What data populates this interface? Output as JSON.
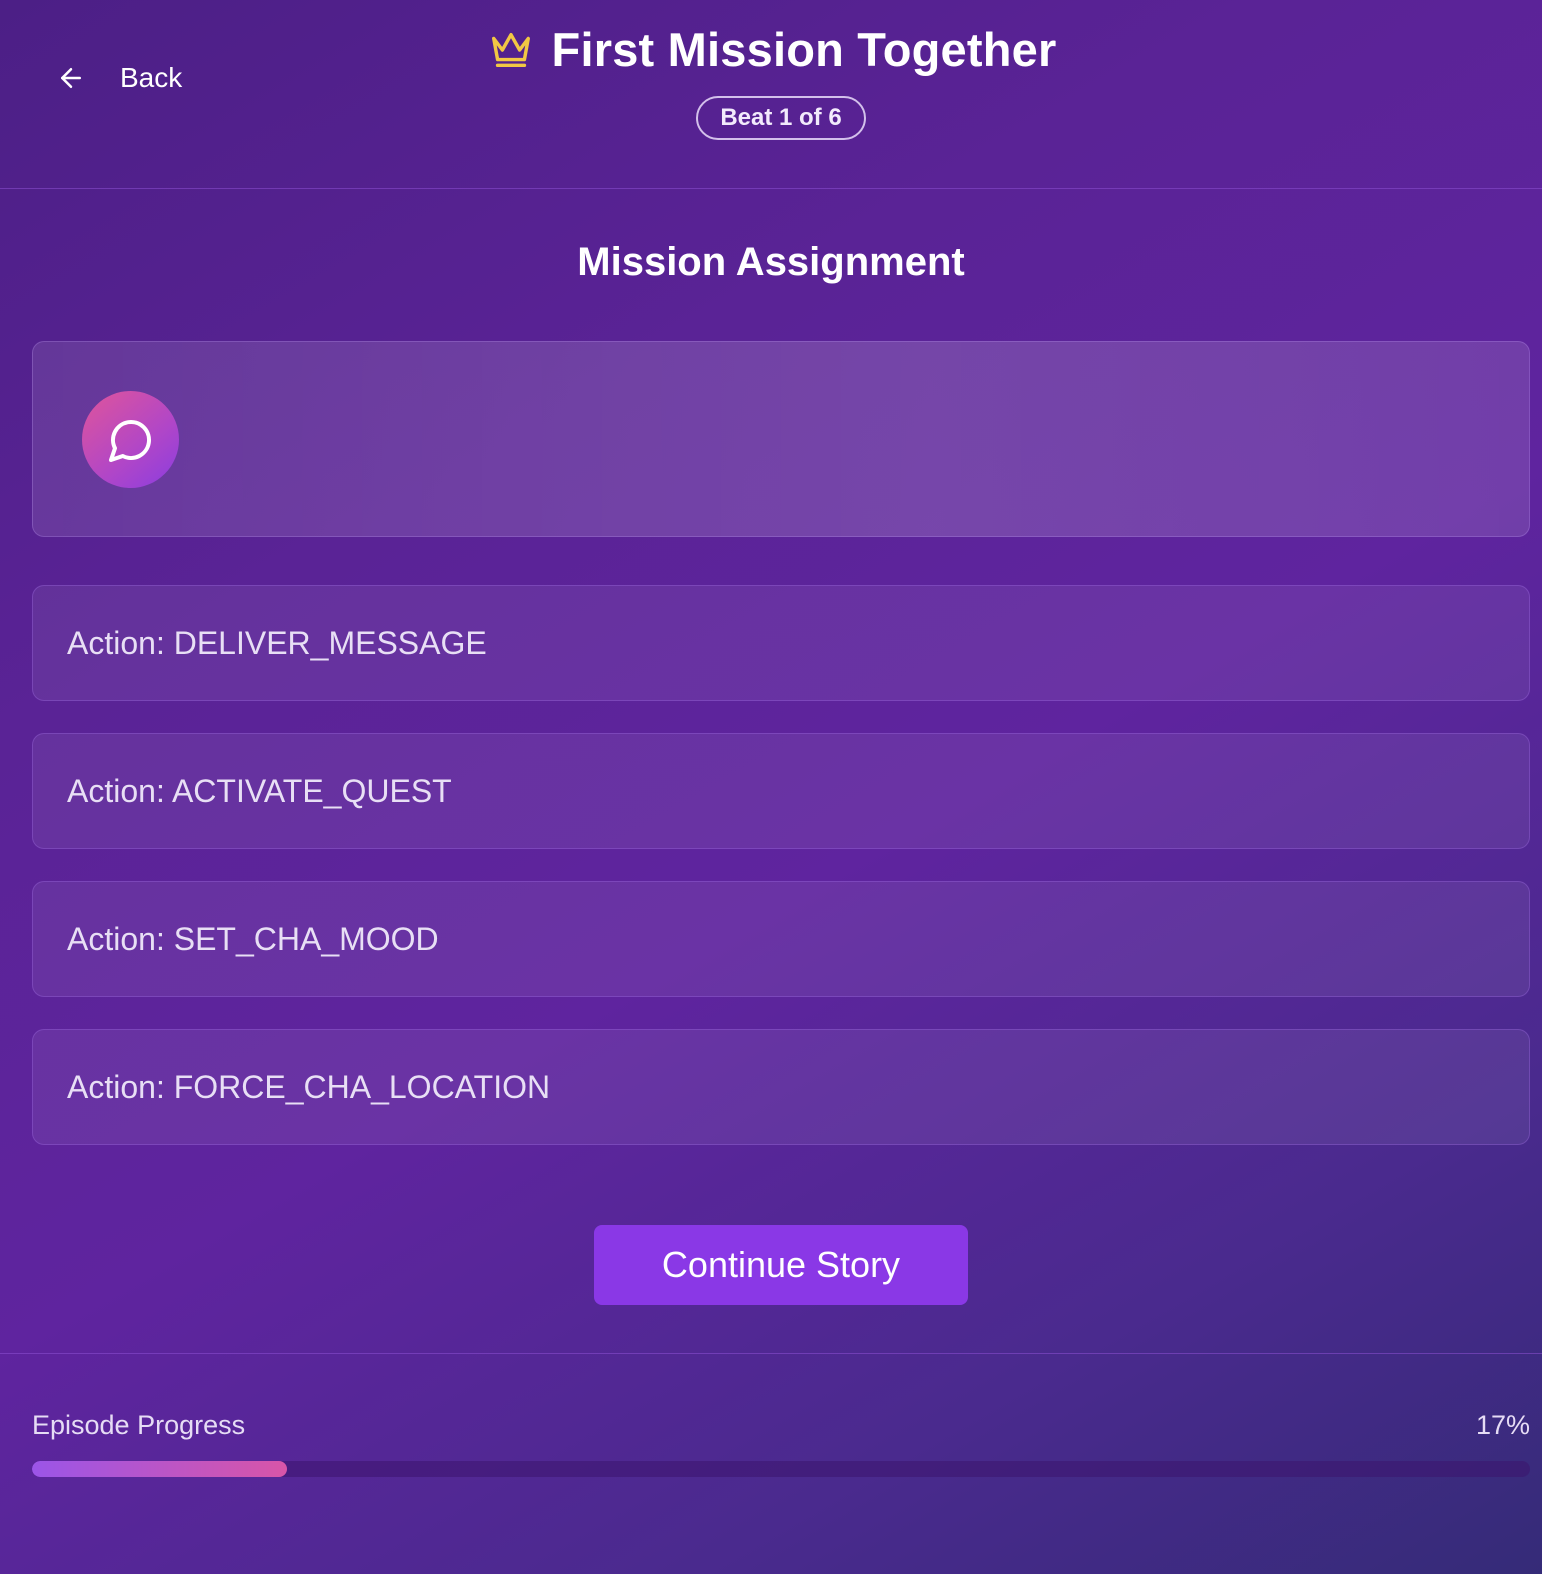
{
  "header": {
    "back_label": "Back",
    "title": "First Mission Together",
    "beat_badge": "Beat 1 of 6"
  },
  "main": {
    "section_title": "Mission Assignment",
    "message_icon": "chat-bubble-icon",
    "actions": [
      "Action: DELIVER_MESSAGE",
      "Action: ACTIVATE_QUEST",
      "Action: SET_CHA_MOOD",
      "Action: FORCE_CHA_LOCATION"
    ],
    "continue_label": "Continue Story"
  },
  "footer": {
    "progress_label": "Episode Progress",
    "progress_text": "17%",
    "progress_value": 0.17
  },
  "colors": {
    "accent": "#8a38e6",
    "crown": "#f2c744",
    "progress_start": "#9b55e8",
    "progress_end": "#d855a8"
  }
}
